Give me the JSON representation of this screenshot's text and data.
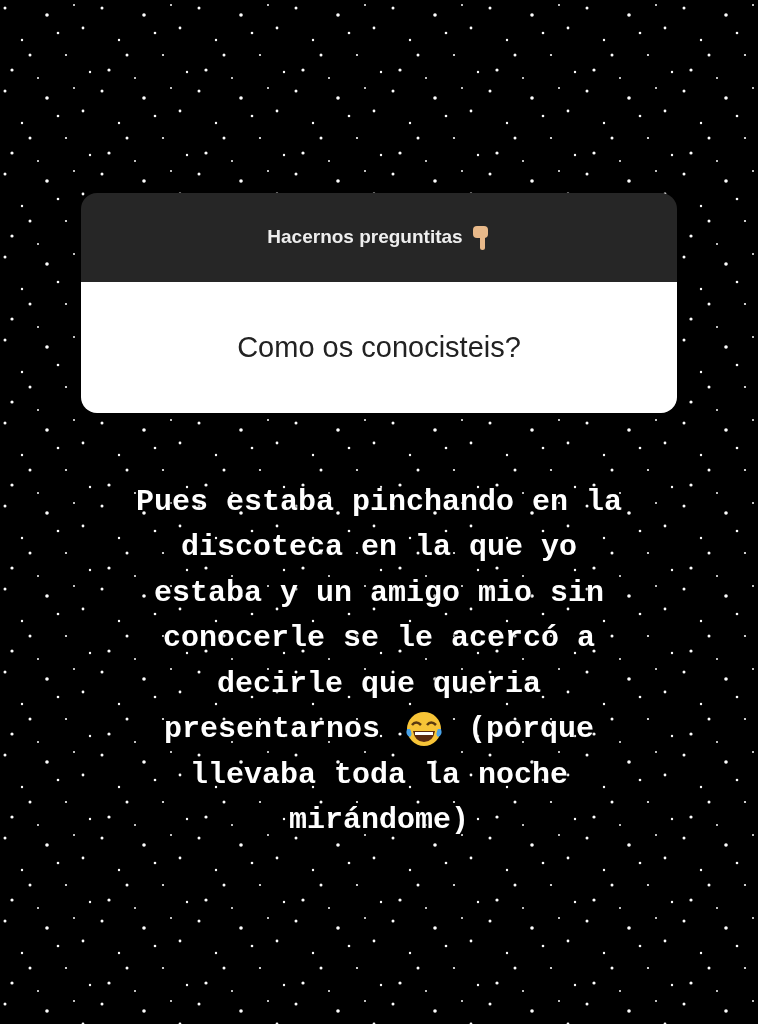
{
  "question_sticker": {
    "title": "Hacernos preguntitas",
    "question": "Como os conocisteis?"
  },
  "answer": {
    "lines": [
      {
        "segments": [
          {
            "kind": "text",
            "text": "Pues estaba pinchando en la"
          }
        ]
      },
      {
        "segments": [
          {
            "kind": "text",
            "text": "discoteca en la que yo"
          }
        ]
      },
      {
        "segments": [
          {
            "kind": "text",
            "text": "estaba y un amigo mio sin"
          }
        ]
      },
      {
        "segments": [
          {
            "kind": "text",
            "text": "conocerle se le acercó a"
          }
        ]
      },
      {
        "segments": [
          {
            "kind": "text",
            "text": "decirle que queria"
          }
        ]
      },
      {
        "segments": [
          {
            "kind": "text",
            "text": "presentarnos"
          },
          {
            "kind": "icon"
          },
          {
            "kind": "text",
            "text": "(porque"
          }
        ]
      },
      {
        "segments": [
          {
            "kind": "text",
            "text": "llevaba toda la noche"
          }
        ]
      },
      {
        "segments": [
          {
            "kind": "text",
            "text": "mirándome)"
          }
        ]
      }
    ]
  }
}
